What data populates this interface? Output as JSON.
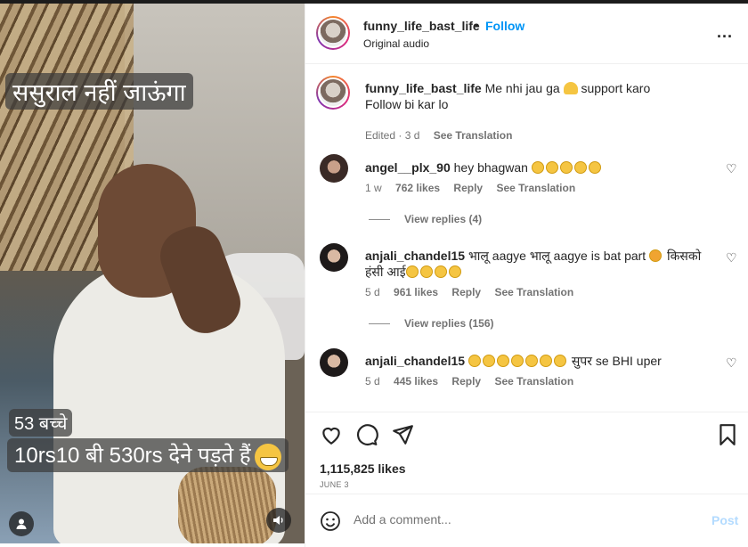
{
  "video": {
    "caption_top": "ससुराल नहीं जाऊंगा",
    "caption_line1": "53 बच्चे",
    "caption_line2": "10rs10 बी 530rs  देने पड़ते हैं"
  },
  "header": {
    "username": "funny_life_bast_life",
    "dot": "•",
    "follow_label": "Follow",
    "audio": "Original audio",
    "more": "..."
  },
  "caption": {
    "username": "funny_life_bast_life",
    "text_a": "Me nhi jau ga",
    "text_b": "support karo",
    "line2": "Follow bi kar lo",
    "edited": "Edited · 3 d",
    "translation": "See Translation"
  },
  "comments": [
    {
      "username": "angel__plx_90",
      "text": "hey bhagwan",
      "time": "1 w",
      "likes": "762 likes",
      "reply": "Reply",
      "translation": "See Translation",
      "view_replies": "View replies (4)"
    },
    {
      "username": "anjali_chandel15",
      "text_a": "भालू aagye भालू aagye is bat part",
      "text_b": "किसको हंसी आई",
      "time": "5 d",
      "likes": "961 likes",
      "reply": "Reply",
      "translation": "See Translation",
      "view_replies": "View replies (156)"
    },
    {
      "username": "anjali_chandel15",
      "text": "सुपर se BHI uper",
      "time": "5 d",
      "likes": "445 likes",
      "reply": "Reply",
      "translation": "See Translation"
    }
  ],
  "post": {
    "likes": "1,115,825 likes",
    "date": "JUNE 3"
  },
  "add_comment": {
    "placeholder": "Add a comment...",
    "post_label": "Post"
  },
  "colors": {
    "accent": "#0095f6",
    "muted": "#737373",
    "post_disabled": "#b3dbff"
  }
}
